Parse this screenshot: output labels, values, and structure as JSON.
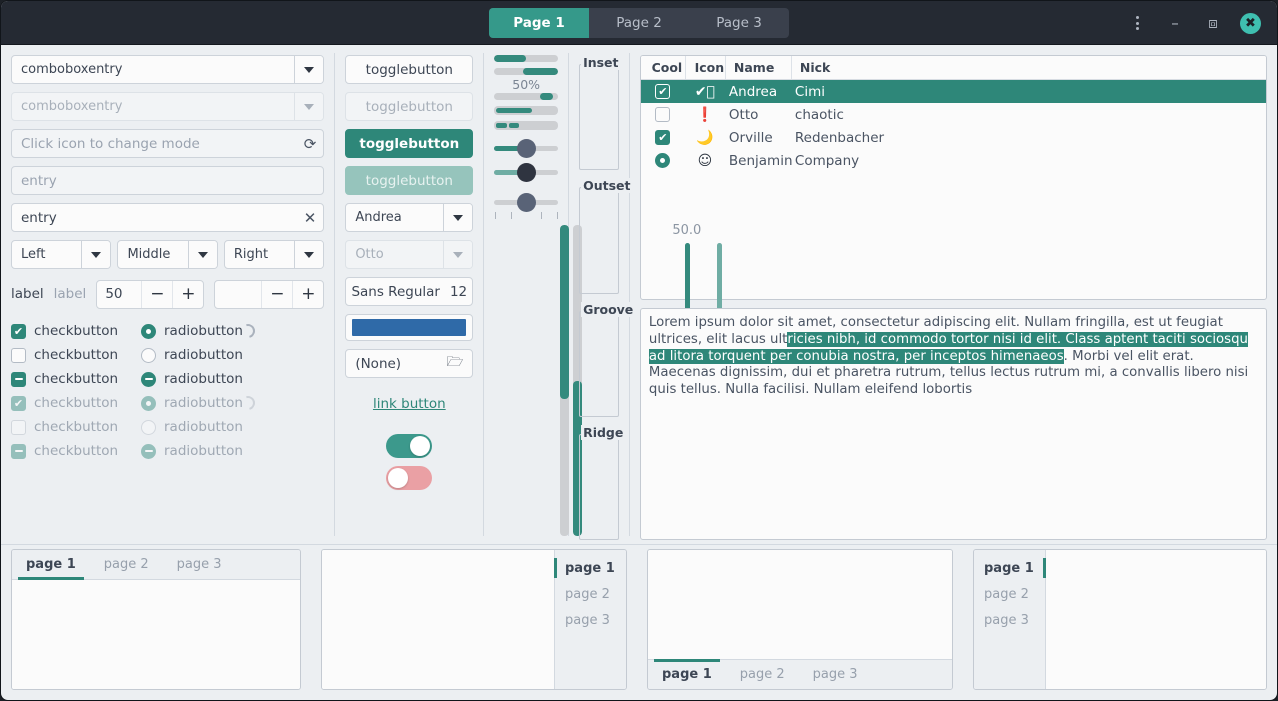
{
  "header": {
    "tabs": [
      {
        "label": "Page 1",
        "active": true
      },
      {
        "label": "Page 2",
        "active": false
      },
      {
        "label": "Page 3",
        "active": false
      }
    ],
    "menu_icon": "menu-dots-icon",
    "minimize_icon": "minimize-icon",
    "maximize_icon": "maximize-icon",
    "close_icon": "close-icon"
  },
  "col1": {
    "combo_entry_1": {
      "value": "comboboxentry",
      "icon": "chevron-down-icon"
    },
    "combo_entry_2": {
      "value": "comboboxentry",
      "icon": "chevron-down-icon",
      "disabled": true
    },
    "mode_entry": {
      "placeholder": "Click icon to change mode",
      "icon": "refresh-icon"
    },
    "plain_entry": {
      "placeholder": "entry"
    },
    "clear_entry": {
      "value": "entry",
      "icon": "clear-icon"
    },
    "combos": [
      {
        "label": "Left"
      },
      {
        "label": "Middle"
      },
      {
        "label": "Right"
      }
    ],
    "spin_row": {
      "label_1": "label",
      "label_2": "label",
      "spin_value": "50",
      "spin_empty_value": "",
      "minus": "−",
      "plus": "+"
    },
    "check_rows": [
      {
        "check_label": "checkbutton",
        "check_state": "on",
        "radio_label": "radiobutton",
        "radio_state": "on",
        "spinner": true,
        "insensitive": false
      },
      {
        "check_label": "checkbutton",
        "check_state": "off",
        "radio_label": "radiobutton",
        "radio_state": "off",
        "spinner": false,
        "insensitive": false
      },
      {
        "check_label": "checkbutton",
        "check_state": "mixed",
        "radio_label": "radiobutton",
        "radio_state": "mixed",
        "spinner": false,
        "insensitive": false
      },
      {
        "check_label": "checkbutton",
        "check_state": "on",
        "radio_label": "radiobutton",
        "radio_state": "on",
        "spinner": true,
        "insensitive": true
      },
      {
        "check_label": "checkbutton",
        "check_state": "off",
        "radio_label": "radiobutton",
        "radio_state": "off",
        "spinner": false,
        "insensitive": true
      },
      {
        "check_label": "checkbutton",
        "check_state": "mixed",
        "radio_label": "radiobutton",
        "radio_state": "mixed",
        "spinner": false,
        "insensitive": true
      }
    ]
  },
  "col2": {
    "toggle_1": "togglebutton",
    "toggle_2": "togglebutton",
    "toggle_3": "togglebutton",
    "toggle_4": "togglebutton",
    "combo_name": "Andrea",
    "combo_name_disabled": "Otto",
    "font_name": "Sans Regular",
    "font_size": "12",
    "color_value": "#2f6aa8",
    "file_label": "(None)",
    "file_icon": "open-folder-icon",
    "link_label": "link button",
    "switch_on": true,
    "switch_off": false
  },
  "col3": {
    "progress_caption": "50%",
    "progress_1_value": 50,
    "progress_2_value": 55,
    "progress_3_value": 20,
    "progress_4_value": 60,
    "level_segments": [
      true,
      true,
      false,
      false,
      false
    ],
    "scale_1_value": 50,
    "scale_2_value": 50,
    "scale_3_value": 50,
    "vertical_label": "50.0",
    "vbar_1_value": 56,
    "vbar_2_value": 50,
    "vscale_1_value": 50,
    "vscale_2_value": 50
  },
  "frames": [
    {
      "label": "Inset"
    },
    {
      "label": "Outset"
    },
    {
      "label": "Groove"
    },
    {
      "label": "Ridge"
    }
  ],
  "treeview": {
    "columns": [
      "Cool",
      "Icon",
      "Name",
      "Nick"
    ],
    "rows": [
      {
        "cool": "checked",
        "icon": "check-circle-icon",
        "name": "Andrea",
        "nick": "Cimi",
        "selected": true
      },
      {
        "cool": "unchecked",
        "icon": "warning-circle-icon",
        "name": "Otto",
        "nick": "chaotic",
        "selected": false
      },
      {
        "cool": "checked",
        "icon": "moon-icon",
        "name": "Orville",
        "nick": "Redenbacher",
        "selected": false
      },
      {
        "cool": "radio-on",
        "icon": "face-icon",
        "name": "Benjamin",
        "nick": "Company",
        "selected": false
      }
    ]
  },
  "textview": {
    "before": "Lorem ipsum dolor sit amet, consectetur adipiscing elit.\nNullam fringilla, est ut feugiat ultrices, elit lacus ult",
    "highlight": "ricies nibh, id commodo tortor nisi id elit.\nClass aptent taciti sociosqu ad litora torquent per conubia nostra, per inceptos himenaeos",
    "after": ".\nMorbi vel elit erat. Maecenas dignissim, dui et pharetra rutrum, tellus lectus rutrum mi, a convallis libero nisi quis tellus.\nNulla facilisi. Nullam eleifend lobortis"
  },
  "notebooks": [
    {
      "position": "top",
      "tabs": [
        {
          "label": "page 1",
          "active": true
        },
        {
          "label": "page 2",
          "active": false
        },
        {
          "label": "page 3",
          "active": false
        }
      ]
    },
    {
      "position": "right",
      "tabs": [
        {
          "label": "page 1",
          "active": true
        },
        {
          "label": "page 2",
          "active": false
        },
        {
          "label": "page 3",
          "active": false
        }
      ]
    },
    {
      "position": "bottom",
      "tabs": [
        {
          "label": "page 1",
          "active": true
        },
        {
          "label": "page 2",
          "active": false
        },
        {
          "label": "page 3",
          "active": false
        }
      ]
    },
    {
      "position": "left",
      "tabs": [
        {
          "label": "page 1",
          "active": true
        },
        {
          "label": "page 2",
          "active": false
        },
        {
          "label": "page 3",
          "active": false
        }
      ]
    }
  ],
  "colors": {
    "accent": "#2e8779",
    "header_bg": "#252a33",
    "window_bg": "#eceff2",
    "close_btn": "#3fbfb0",
    "switch_off": "#eaa0a4",
    "color_swatch": "#2f6aa8"
  }
}
